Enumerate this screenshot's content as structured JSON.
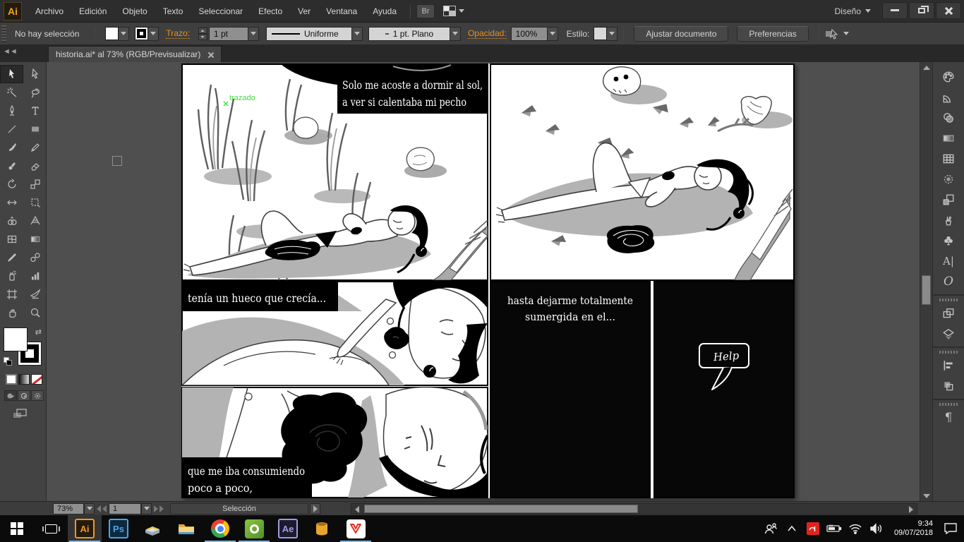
{
  "titlebar": {
    "logo": "Ai",
    "menus": [
      "Archivo",
      "Edición",
      "Objeto",
      "Texto",
      "Seleccionar",
      "Efecto",
      "Ver",
      "Ventana",
      "Ayuda"
    ],
    "bridge_label": "Br",
    "workspace": "Diseño"
  },
  "controlbar": {
    "selection_status": "No hay selección",
    "stroke_label": "Trazo:",
    "stroke_width": "1 pt",
    "width_profile": "Uniforme",
    "brush_definition": "1 pt. Plano",
    "opacity_label": "Opacidad:",
    "opacity_value": "100%",
    "style_label": "Estilo:",
    "fit_document_btn": "Ajustar documento",
    "preferences_btn": "Preferencias"
  },
  "tab": {
    "title": "historia.ai* al 73% (RGB/Previsualizar)"
  },
  "canvas": {
    "annotation": "trazado",
    "annotation_color": "#3fe03f"
  },
  "comic": {
    "panel1_caption": [
      "Solo me acoste a dormir al sol,",
      "a ver si calentaba mi pecho"
    ],
    "panel3_caption": "tenía un hueco que crecía...",
    "panel4_caption": [
      "que me iba consumiendo",
      "poco a poco,"
    ],
    "panel5_caption": [
      "hasta dejarme totalmente",
      "sumergida en el..."
    ],
    "help_text": "Help"
  },
  "statusbar": {
    "zoom_level": "73%",
    "artboard_number": "1",
    "status_text": "Selección"
  },
  "taskbar": {
    "app_labels": {
      "illustrator": "Ai",
      "photoshop": "Ps",
      "after_effects": "Ae"
    },
    "clock_time": "9:34",
    "clock_date": "09/07/2018"
  },
  "tools": [
    "selection",
    "direct-selection",
    "magic-wand",
    "lasso",
    "pen",
    "type",
    "line-segment",
    "rectangle",
    "paintbrush",
    "pencil",
    "blob-brush",
    "eraser",
    "rotate",
    "scale",
    "width",
    "free-transform",
    "shape-builder",
    "perspective-grid",
    "mesh",
    "gradient",
    "eyedropper",
    "blend",
    "symbol-sprayer",
    "column-graph",
    "artboard",
    "slice",
    "hand",
    "zoom"
  ],
  "right_panel_icons": [
    "color",
    "color-guide",
    "transparency",
    "gradient",
    "swatches",
    "appearance",
    "graphic-styles",
    "brushes",
    "symbols",
    "character",
    "opentype",
    "artboards",
    "layers",
    "align",
    "pathfinder",
    "paragraph"
  ],
  "icon_glyphs": {
    "character_glyph": "A|",
    "opentype_glyph": "O",
    "paragraph_glyph": "¶",
    "swap_glyph": "⇄"
  },
  "colors": {
    "accent_orange": "#e8921e",
    "taskbar_run_blue": "#76b9ed",
    "annotation_green": "#3fe03f",
    "avira_red": "#e0231e"
  }
}
